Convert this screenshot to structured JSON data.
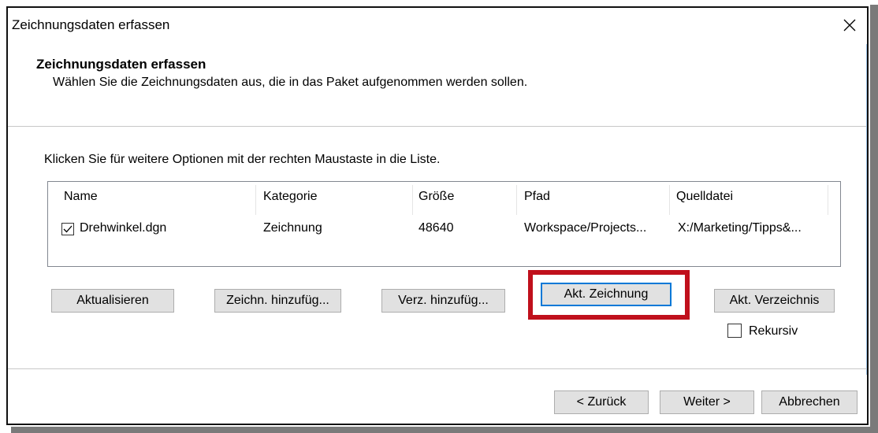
{
  "window": {
    "title": "Zeichnungsdaten erfassen",
    "close_icon": "close-icon"
  },
  "header": {
    "title": "Zeichnungsdaten erfassen",
    "subtitle": "Wählen Sie die Zeichnungsdaten aus, die in das Paket aufgenommen werden sollen."
  },
  "hint": "Klicken Sie für weitere Optionen mit der rechten Maustaste in die Liste.",
  "list": {
    "columns": [
      "Name",
      "Kategorie",
      "Größe",
      "Pfad",
      "Quelldatei"
    ],
    "rows": [
      {
        "checked": true,
        "name": "Drehwinkel.dgn",
        "category": "Zeichnung",
        "size": "48640",
        "path": "Workspace/Projects...",
        "source": "X:/Marketing/Tipps&..."
      }
    ]
  },
  "buttons": {
    "refresh": "Aktualisieren",
    "add_drawing": "Zeichn. hinzufüg...",
    "add_folder": "Verz. hinzufüg...",
    "current_drawing": "Akt. Zeichnung",
    "current_folder": "Akt. Verzeichnis",
    "back": "< Zurück",
    "next": "Weiter >",
    "cancel": "Abbrechen"
  },
  "recursive": {
    "label": "Rekursiv",
    "checked": false
  },
  "colors": {
    "highlight_box": "#c0101c",
    "focus_border": "#0078d7"
  }
}
